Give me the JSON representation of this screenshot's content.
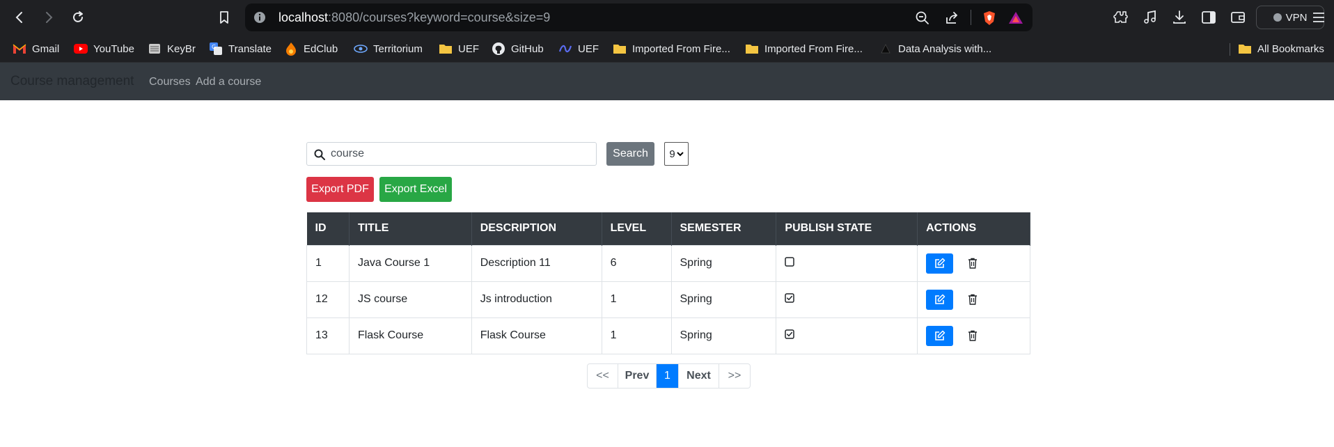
{
  "browser": {
    "url_host": "localhost",
    "url_rest": ":8080/courses?keyword=course&size=9",
    "vpn_label": "VPN",
    "bookmarks": [
      {
        "label": "Gmail",
        "icon": "gmail-icon"
      },
      {
        "label": "YouTube",
        "icon": "youtube-icon"
      },
      {
        "label": "KeyBr",
        "icon": "keybr-icon"
      },
      {
        "label": "Translate",
        "icon": "translate-icon"
      },
      {
        "label": "EdClub",
        "icon": "edclub-icon"
      },
      {
        "label": "Territorium",
        "icon": "territorium-icon"
      },
      {
        "label": "UEF",
        "icon": "folder-icon"
      },
      {
        "label": "GitHub",
        "icon": "github-icon"
      },
      {
        "label": "UEF",
        "icon": "uef-icon"
      },
      {
        "label": "Imported From Fire...",
        "icon": "folder-icon"
      },
      {
        "label": "Imported From Fire...",
        "icon": "folder-icon"
      },
      {
        "label": "Data Analysis with...",
        "icon": "data-analysis-icon"
      }
    ],
    "all_bookmarks_label": "All Bookmarks"
  },
  "navbar": {
    "brand": "Course management",
    "links": [
      "Courses",
      "Add a course"
    ]
  },
  "search": {
    "value": "course",
    "button_label": "Search",
    "page_size": "9"
  },
  "export": {
    "pdf_label": "Export PDF",
    "excel_label": "Export Excel"
  },
  "table": {
    "headers": [
      "ID",
      "TITLE",
      "DESCRIPTION",
      "LEVEL",
      "SEMESTER",
      "PUBLISH STATE",
      "ACTIONS"
    ],
    "rows": [
      {
        "id": "1",
        "title": "Java Course 1",
        "description": "Description 11",
        "level": "6",
        "semester": "Spring",
        "published": false
      },
      {
        "id": "12",
        "title": "JS course",
        "description": "Js introduction",
        "level": "1",
        "semester": "Spring",
        "published": true
      },
      {
        "id": "13",
        "title": "Flask Course",
        "description": "Flask Course",
        "level": "1",
        "semester": "Spring",
        "published": true
      }
    ]
  },
  "pagination": {
    "first": "<<",
    "prev": "Prev",
    "current": "1",
    "next": "Next",
    "last": ">>"
  },
  "colors": {
    "primary": "#007bff",
    "danger": "#dc3545",
    "success": "#28a745",
    "secondary": "#6c757d",
    "dark": "#343a40"
  }
}
